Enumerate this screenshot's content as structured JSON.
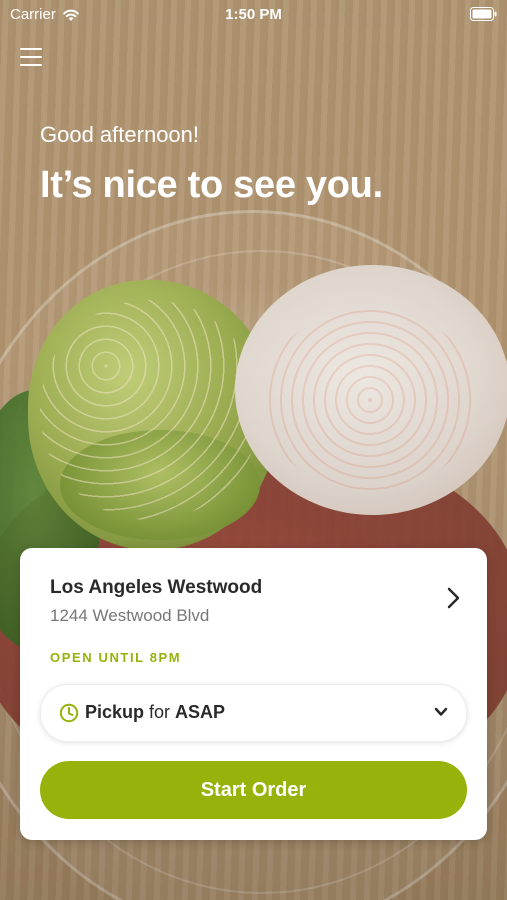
{
  "status_bar": {
    "carrier": "Carrier",
    "time": "1:50 PM",
    "icons": [
      "wifi-icon",
      "battery-icon"
    ]
  },
  "header": {
    "menu_icon": "menu-icon",
    "greeting": "Good afternoon!",
    "headline": "It’s nice to see you."
  },
  "store": {
    "name": "Los Angeles Westwood",
    "address": "1244 Westwood Blvd",
    "hours": "OPEN UNTIL 8PM",
    "chevron_icon": "chevron-right-icon"
  },
  "order_mode": {
    "icon": "clock-icon",
    "method": "Pickup",
    "connector": "for",
    "time": "ASAP",
    "dropdown_icon": "chevron-down-icon"
  },
  "actions": {
    "start_order": "Start Order"
  },
  "colors": {
    "accent": "#97b20b",
    "card_background": "#ffffff",
    "text_primary": "#2a2a2a",
    "text_secondary": "#777777"
  }
}
